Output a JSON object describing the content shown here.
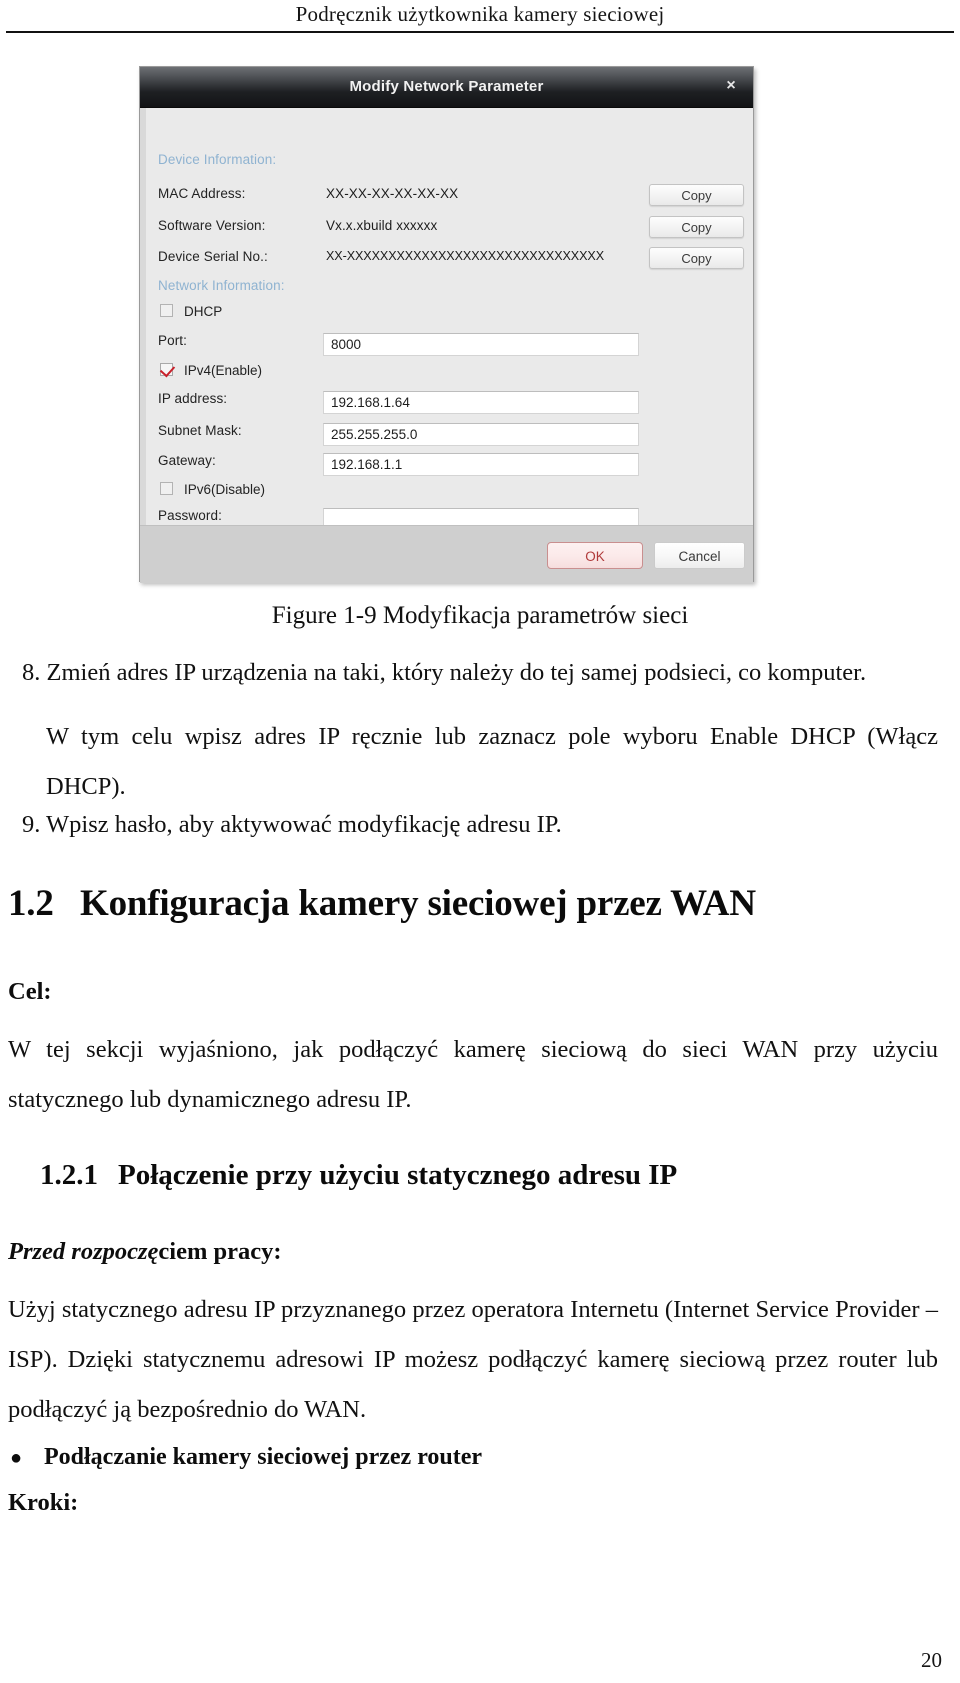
{
  "header": {
    "running_title": "Podręcznik użytkownika kamery sieciowej"
  },
  "dialog": {
    "title": "Modify Network Parameter",
    "close_glyph": "×",
    "sections": {
      "device_information": "Device Information:",
      "network_information": "Network Information:"
    },
    "device_info": [
      {
        "label": "MAC Address:",
        "value": "XX-XX-XX-XX-XX-XX",
        "button": "Copy"
      },
      {
        "label": "Software Version:",
        "value": "Vx.x.xbuild xxxxxx",
        "button": "Copy"
      },
      {
        "label": "Device Serial No.:",
        "value": "XX-XXXXXXXXXXXXXXXXXXXXXXXXXXXXXXX",
        "button": "Copy"
      }
    ],
    "dhcp_checkbox": {
      "label": "DHCP",
      "checked": false
    },
    "port": {
      "label": "Port:",
      "value": "8000"
    },
    "ipv4_checkbox": {
      "label": "IPv4(Enable)",
      "checked": true
    },
    "ip_address": {
      "label": "IP address:",
      "value": "192.168.1.64"
    },
    "subnet_mask": {
      "label": "Subnet Mask:",
      "value": "255.255.255.0"
    },
    "gateway": {
      "label": "Gateway:",
      "value": "192.168.1.1"
    },
    "ipv6_checkbox": {
      "label": "IPv6(Disable)",
      "checked": false
    },
    "password": {
      "label": "Password:",
      "value": ""
    },
    "buttons": {
      "ok": "OK",
      "cancel": "Cancel"
    },
    "colors": {
      "titlebar_dark": "#1e2023",
      "section_label_blue": "#8fb3d1",
      "check_red": "#c8202a",
      "ok_border": "#c98f8f",
      "ok_text": "#b03a3a"
    }
  },
  "document": {
    "figure_caption": "Figure 1-9 Modyfikacja parametrów sieci",
    "step_8": "8. Zmień adres IP urządzenia na taki, który należy do tej samej podsieci, co komputer.",
    "step_8_cont": "W tym celu wpisz adres IP ręcznie lub zaznacz pole wyboru Enable DHCP (Włącz DHCP).",
    "step_9": "9. Wpisz hasło, aby aktywować modyfikację adresu IP.",
    "heading_1_2": {
      "number": "1.2",
      "text": "Konfiguracja kamery sieciowej przez WAN"
    },
    "cel_label": "Cel:",
    "cel_paragraph": "W tej sekcji wyjaśniono, jak podłączyć kamerę sieciową do sieci WAN przy użyciu statycznego lub dynamicznego adresu IP.",
    "heading_1_2_1": {
      "number": "1.2.1",
      "text": "Połączenie przy użyciu statycznego adresu IP"
    },
    "before_start_label_italic": "Przed rozpoczę",
    "before_start_label_rest": "ciem pracy:",
    "before_start_paragraph": "Użyj statycznego adresu IP przyznanego przez operatora Internetu (Internet Service Provider – ISP). Dzięki statycznemu adresowi IP możesz podłączyć kamerę sieciową przez router lub podłączyć ją bezpośrednio do WAN.",
    "bullet_dot": "●",
    "bullet_item": "Podłączanie kamery sieciowej przez router",
    "kroki_label": "Kroki:",
    "page_number": "20"
  }
}
